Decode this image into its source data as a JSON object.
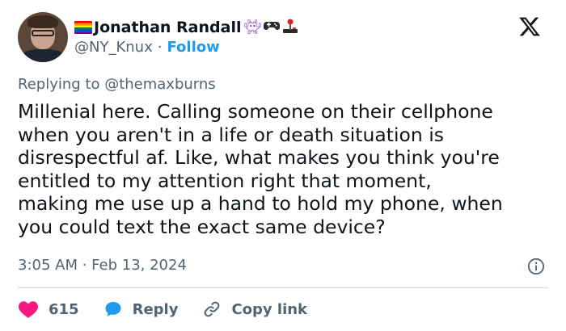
{
  "author": {
    "display_name": "Jonathan Randall",
    "handle": "@NY_Knux",
    "follow_label": "Follow",
    "name_emojis": [
      "rainbow-flag-icon",
      "space-invader-icon",
      "game-controller-icon",
      "joystick-icon"
    ]
  },
  "reply_context": "Replying to @themaxburns",
  "tweet": {
    "lines": [
      "Millenial here. Calling someone on their cellphone",
      "when you aren't in a life or death situation  is",
      "disrespectful af. Like, what makes you think you're",
      "entitled to my attention right that moment,",
      "making me use up a hand to hold my phone, when",
      "you could text the exact same device?"
    ]
  },
  "timestamp": "3:05 AM · Feb 13, 2024",
  "actions": {
    "likes_count": "615",
    "reply_label": "Reply",
    "copy_label": "Copy link"
  },
  "colors": {
    "accent": "#1d9bf0",
    "like": "#f91880",
    "muted": "#536471",
    "text": "#0f1419"
  }
}
